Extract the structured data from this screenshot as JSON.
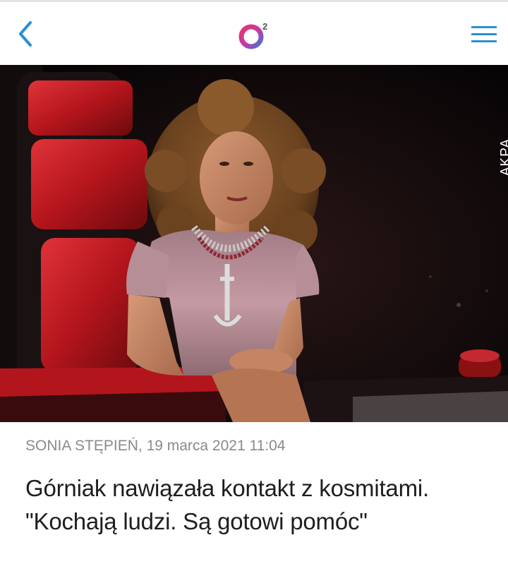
{
  "header": {
    "back_icon": "chevron-left-icon",
    "logo_icon": "o2-logo",
    "logo_superscript": "2",
    "menu_icon": "hamburger-menu-icon",
    "accent_color": "#2a8fd6"
  },
  "article": {
    "photo_credit": "AKPA",
    "author": "SONIA STĘPIEŃ",
    "date": "19 marca 2021 11:04",
    "title_line1": "Górniak nawiązała kontakt z kosmitami.",
    "title_line2": "\"Kochają ludzi. Są gotowi pomóc\""
  }
}
